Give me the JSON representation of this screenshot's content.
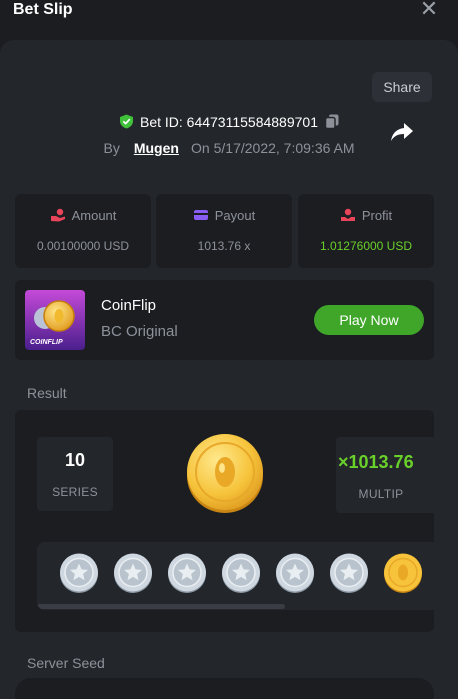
{
  "header": {
    "title": "Bet Slip",
    "close_icon": "close-icon"
  },
  "share": {
    "tooltip": "Share",
    "icon": "share-arrow-icon"
  },
  "bet": {
    "id_text": "Bet ID: 64473115584889701",
    "by_label": "By",
    "user": "Mugen",
    "on_label": "On",
    "date": "5/17/2022, 7:09:36 AM"
  },
  "stats": {
    "amount": {
      "label": "Amount",
      "value": "0.00100000 USD",
      "icon": "coins-hand-icon"
    },
    "payout": {
      "label": "Payout",
      "value": "1013.76 x",
      "icon": "card-icon"
    },
    "profit": {
      "label": "Profit",
      "value": "1.01276000 USD",
      "icon": "money-hand-icon"
    }
  },
  "game": {
    "thumb_text": "COINFLIP",
    "name": "CoinFlip",
    "provider": "BC Original",
    "play_label": "Play Now"
  },
  "result": {
    "label": "Result",
    "series_value": "10",
    "series_label": "SERIES",
    "multiplier_value": "×1013.76",
    "multiplier_label": "MULTIP",
    "coins": [
      "silver",
      "silver",
      "silver",
      "silver",
      "silver",
      "silver",
      "gold"
    ]
  },
  "server_seed": {
    "label": "Server Seed"
  },
  "colors": {
    "background": "#1b1d21",
    "panel": "#23262b",
    "accent_green": "#6ad12b",
    "button_green": "#3fa62a",
    "muted_text": "#8d929a"
  }
}
